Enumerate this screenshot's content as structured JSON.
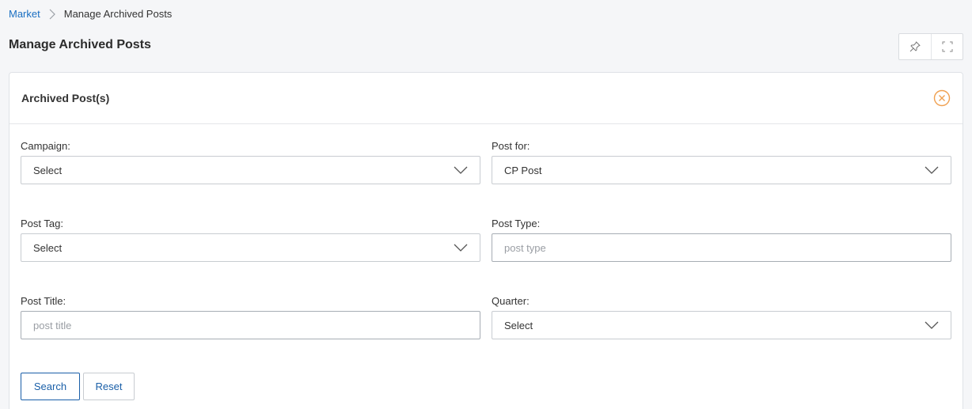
{
  "breadcrumb": {
    "root": "Market",
    "current": "Manage Archived Posts"
  },
  "page": {
    "title": "Manage Archived Posts"
  },
  "panel": {
    "title": "Archived Post(s)"
  },
  "form": {
    "campaign": {
      "label": "Campaign:",
      "value": "Select"
    },
    "post_for": {
      "label": "Post for:",
      "value": "CP Post"
    },
    "post_tag": {
      "label": "Post Tag:",
      "value": "Select"
    },
    "post_type": {
      "label": "Post Type:",
      "value": "",
      "placeholder": "post type"
    },
    "post_title": {
      "label": "Post Title:",
      "value": "",
      "placeholder": "post title"
    },
    "quarter": {
      "label": "Quarter:",
      "value": "Select"
    }
  },
  "actions": {
    "search_label": "Search",
    "reset_label": "Reset"
  },
  "icons": {
    "pin": "pin-icon",
    "fullscreen": "fullscreen-icon",
    "close": "close-circle-icon",
    "chevron": "chevron-down-icon",
    "separator": "chevron-right-icon"
  },
  "colors": {
    "link": "#1a6fc2",
    "close_accent": "#f0a050",
    "button_text": "#1a5fa8"
  }
}
